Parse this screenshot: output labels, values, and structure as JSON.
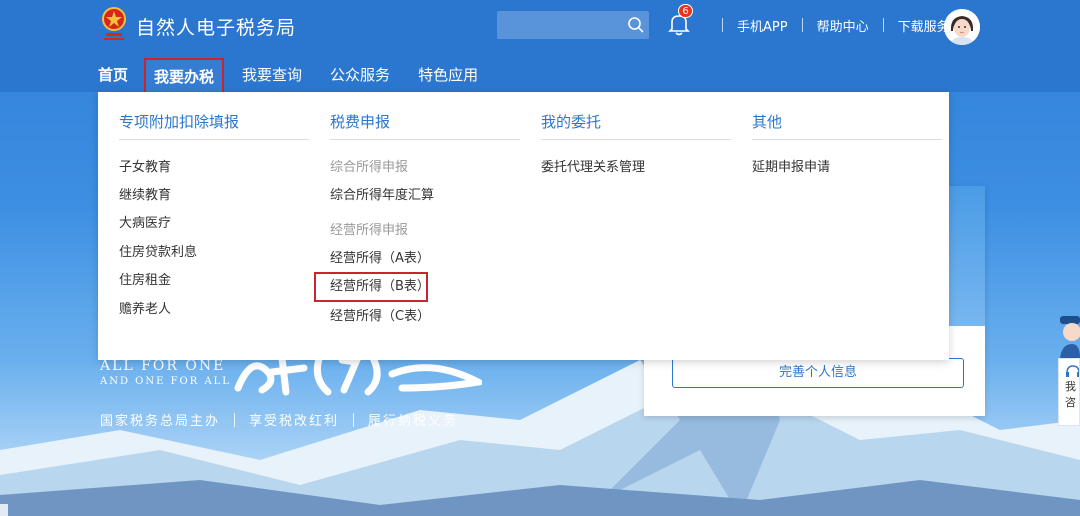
{
  "header": {
    "site_title": "自然人电子税务局",
    "search_placeholder": "",
    "notification_count": "6",
    "links": [
      "手机APP",
      "帮助中心",
      "下载服务"
    ]
  },
  "nav": {
    "items": [
      "首页",
      "我要办税",
      "我要查询",
      "公众服务",
      "特色应用"
    ],
    "active": "我要办税"
  },
  "dropdown": {
    "col1": {
      "title": "专项附加扣除填报",
      "items": [
        "子女教育",
        "继续教育",
        "大病医疗",
        "住房贷款利息",
        "住房租金",
        "赡养老人"
      ]
    },
    "col2": {
      "title": "税费申报",
      "group1": "综合所得申报",
      "item1": "综合所得年度汇算",
      "group2": "经营所得申报",
      "item2": "经营所得（A表）",
      "item3": "经营所得（B表）",
      "item4": "经营所得（C表）"
    },
    "col3": {
      "title": "我的委托",
      "items": [
        "委托代理关系管理"
      ]
    },
    "col4": {
      "title": "其他",
      "items": [
        "延期申报申请"
      ]
    }
  },
  "hero": {
    "slogan_en_1": "ALL FOR ONE",
    "slogan_en_2": "AND ONE FOR ALL",
    "slogan_parts": [
      "国家税务总局主办",
      "享受税改红利",
      "履行纳税义务"
    ]
  },
  "login_card": {
    "complete_button": "完善个人信息"
  },
  "float_service": {
    "lines": [
      "我",
      "咨"
    ]
  },
  "colors": {
    "brand_blue": "#2b77d0",
    "highlight_red": "#c8262c",
    "badge_red": "#e8341c"
  }
}
